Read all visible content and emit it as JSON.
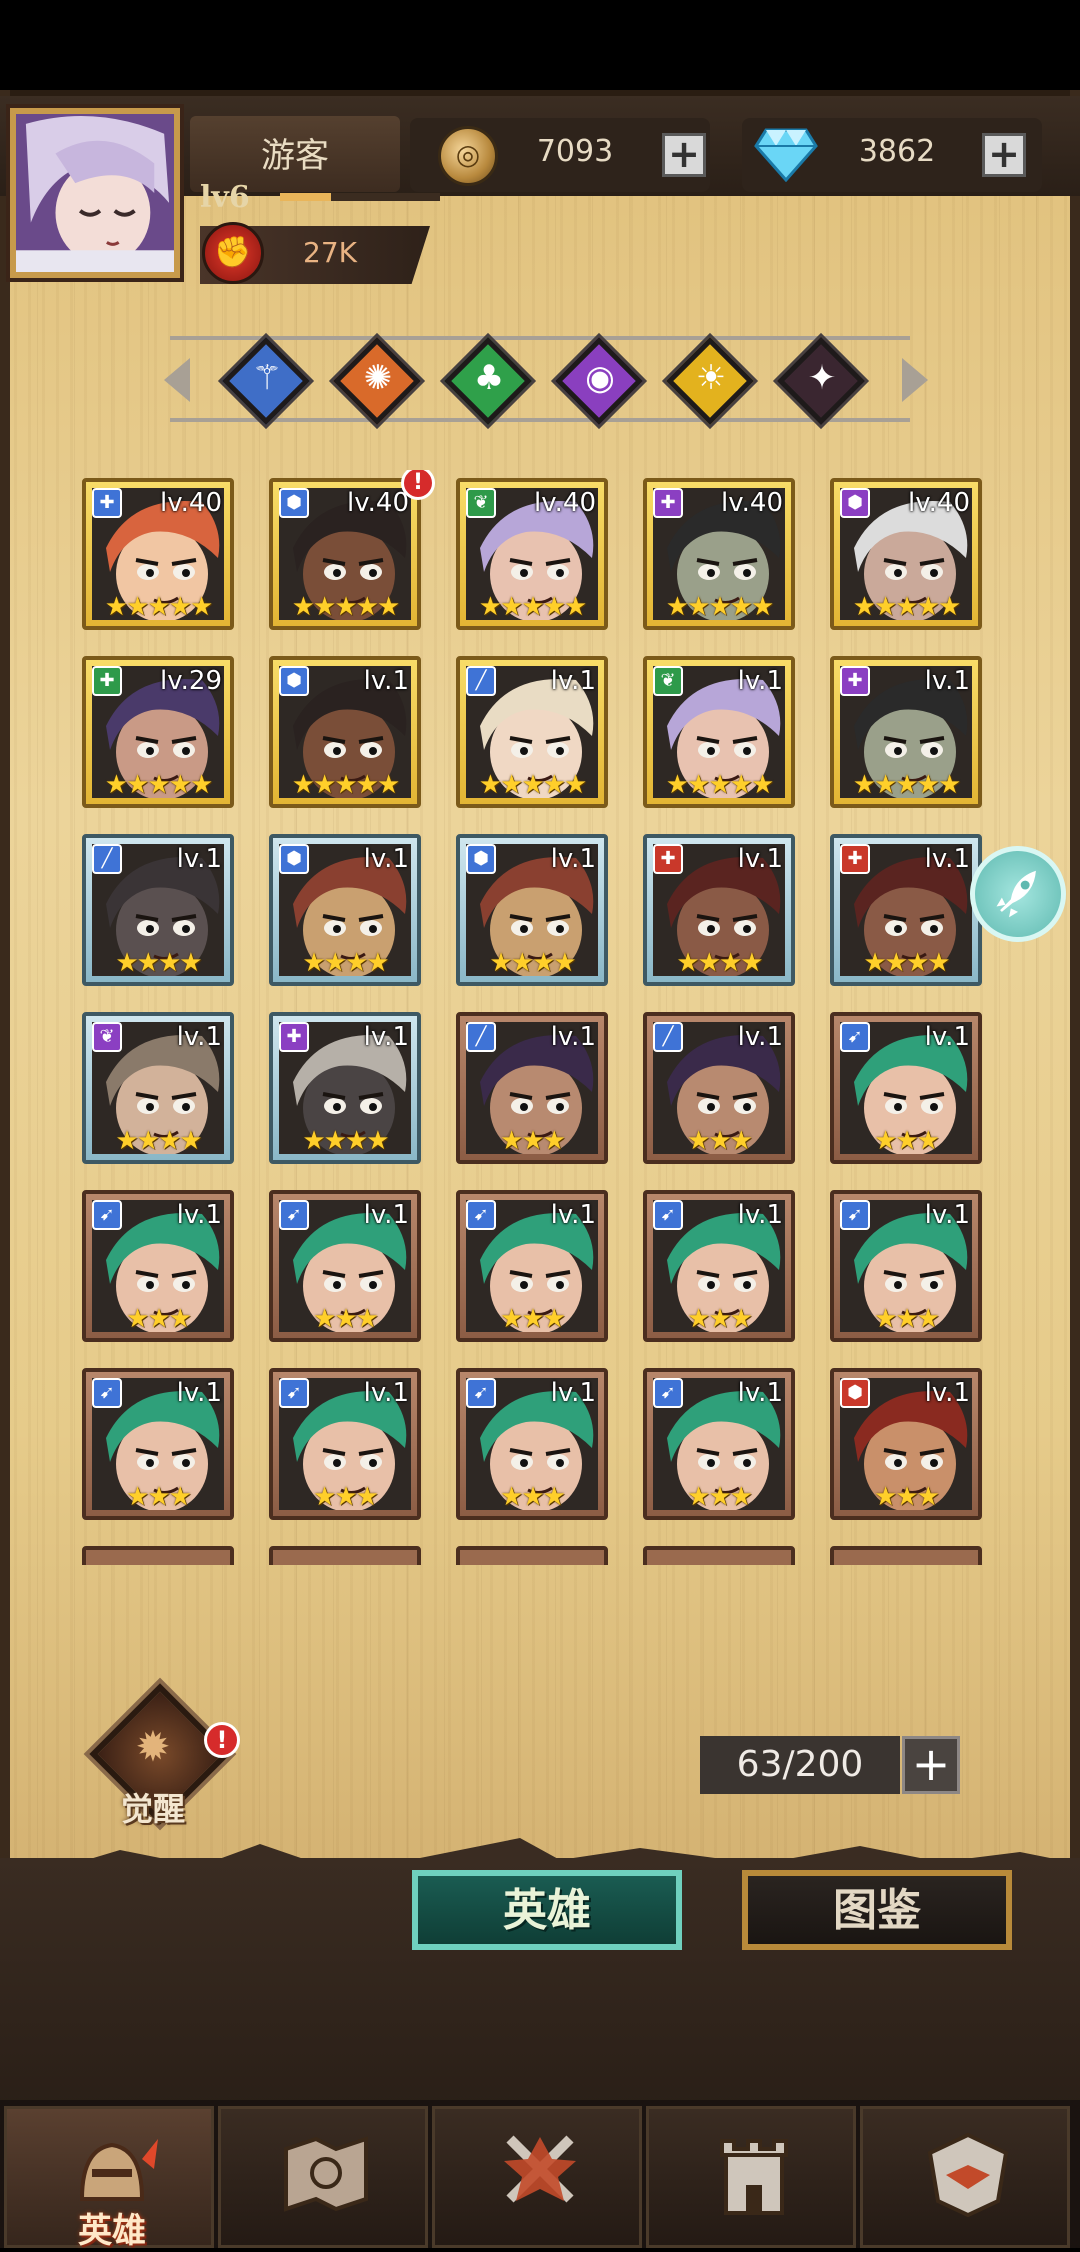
{
  "player": {
    "name": "游客",
    "level": "lv6",
    "exp_fraction": 0.32,
    "power": "27K",
    "power_icon": "fist-icon"
  },
  "currencies": [
    {
      "name": "coin",
      "icon": "coin-icon",
      "value": "7093"
    },
    {
      "name": "gem",
      "icon": "diamond-icon",
      "value": "3862"
    }
  ],
  "factions": [
    {
      "icon": "faction-blue-icon",
      "glyph": "⚚",
      "color": "#3f6ec7"
    },
    {
      "icon": "faction-orange-icon",
      "glyph": "✺",
      "color": "#d96a2a"
    },
    {
      "icon": "faction-green-icon",
      "glyph": "♣",
      "color": "#2fa04a"
    },
    {
      "icon": "faction-purple-icon",
      "glyph": "◉",
      "color": "#8a3fbf"
    },
    {
      "icon": "faction-yellow-icon",
      "glyph": "☀",
      "color": "#e3b21e"
    },
    {
      "icon": "faction-dark-icon",
      "glyph": "✦",
      "color": "#3a2630"
    }
  ],
  "class_colors": {
    "blue": "#3f73d6",
    "green": "#2e9a4a",
    "purple": "#8b3fc2",
    "red": "#c9382a"
  },
  "heroes": [
    {
      "level": "lv.40",
      "stars": 5,
      "tier": "gold",
      "cls": "blue",
      "cls_glyph": "✚",
      "hair": "#d8643e",
      "skin": "#f1c6a3",
      "alert": false
    },
    {
      "level": "lv.40",
      "stars": 5,
      "tier": "gold",
      "cls": "blue",
      "cls_glyph": "⬢",
      "hair": "#2a2220",
      "skin": "#7a4e38",
      "alert": true
    },
    {
      "level": "lv.40",
      "stars": 5,
      "tier": "gold",
      "cls": "green",
      "cls_glyph": "❦",
      "hair": "#b7a6d8",
      "skin": "#e8c2b0",
      "alert": false
    },
    {
      "level": "lv.40",
      "stars": 5,
      "tier": "gold",
      "cls": "purple",
      "cls_glyph": "✚",
      "hair": "#2a2a2a",
      "skin": "#9aa08a",
      "alert": false
    },
    {
      "level": "lv.40",
      "stars": 5,
      "tier": "gold",
      "cls": "purple",
      "cls_glyph": "⬢",
      "hair": "#dcdcdc",
      "skin": "#caa99a",
      "alert": false
    },
    {
      "level": "lv.29",
      "stars": 5,
      "tier": "gold",
      "cls": "green",
      "cls_glyph": "✚",
      "hair": "#4a3a6a",
      "skin": "#c99a86",
      "alert": false
    },
    {
      "level": "lv.1",
      "stars": 5,
      "tier": "gold",
      "cls": "blue",
      "cls_glyph": "⬢",
      "hair": "#2a2220",
      "skin": "#7a4e38",
      "alert": false
    },
    {
      "level": "lv.1",
      "stars": 5,
      "tier": "gold",
      "cls": "blue",
      "cls_glyph": "╱",
      "hair": "#e9dcc4",
      "skin": "#f0d8c4",
      "alert": false
    },
    {
      "level": "lv.1",
      "stars": 5,
      "tier": "gold",
      "cls": "green",
      "cls_glyph": "❦",
      "hair": "#b7a6d8",
      "skin": "#e8c2b0",
      "alert": false
    },
    {
      "level": "lv.1",
      "stars": 5,
      "tier": "gold",
      "cls": "purple",
      "cls_glyph": "✚",
      "hair": "#2a2a2a",
      "skin": "#9aa08a",
      "alert": false
    },
    {
      "level": "lv.1",
      "stars": 4,
      "tier": "blue",
      "cls": "blue",
      "cls_glyph": "╱",
      "hair": "#3a3436",
      "skin": "#5a5050",
      "alert": false
    },
    {
      "level": "lv.1",
      "stars": 4,
      "tier": "blue",
      "cls": "blue",
      "cls_glyph": "⬢",
      "hair": "#8a4030",
      "skin": "#c9a070",
      "alert": false
    },
    {
      "level": "lv.1",
      "stars": 4,
      "tier": "blue",
      "cls": "blue",
      "cls_glyph": "⬢",
      "hair": "#8a4030",
      "skin": "#c9a070",
      "alert": false
    },
    {
      "level": "lv.1",
      "stars": 4,
      "tier": "blue",
      "cls": "red",
      "cls_glyph": "✚",
      "hair": "#5a2420",
      "skin": "#8a5a46",
      "alert": false
    },
    {
      "level": "lv.1",
      "stars": 4,
      "tier": "blue",
      "cls": "red",
      "cls_glyph": "✚",
      "hair": "#5a2420",
      "skin": "#8a5a46",
      "alert": false
    },
    {
      "level": "lv.1",
      "stars": 4,
      "tier": "blue",
      "cls": "purple",
      "cls_glyph": "❦",
      "hair": "#8a7a6a",
      "skin": "#d2b29a",
      "alert": false
    },
    {
      "level": "lv.1",
      "stars": 4,
      "tier": "blue",
      "cls": "purple",
      "cls_glyph": "✚",
      "hair": "#b6b0a8",
      "skin": "#4a4444",
      "alert": false
    },
    {
      "level": "lv.1",
      "stars": 3,
      "tier": "bronze",
      "cls": "blue",
      "cls_glyph": "╱",
      "hair": "#3a2a4a",
      "skin": "#b88a70",
      "alert": false
    },
    {
      "level": "lv.1",
      "stars": 3,
      "tier": "bronze",
      "cls": "blue",
      "cls_glyph": "╱",
      "hair": "#3a2a4a",
      "skin": "#b88a70",
      "alert": false
    },
    {
      "level": "lv.1",
      "stars": 3,
      "tier": "bronze",
      "cls": "blue",
      "cls_glyph": "➹",
      "hair": "#2fa07a",
      "skin": "#e8c0a8",
      "alert": false
    },
    {
      "level": "lv.1",
      "stars": 3,
      "tier": "bronze",
      "cls": "blue",
      "cls_glyph": "➹",
      "hair": "#2fa07a",
      "skin": "#e8c0a8",
      "alert": false
    },
    {
      "level": "lv.1",
      "stars": 3,
      "tier": "bronze",
      "cls": "blue",
      "cls_glyph": "➹",
      "hair": "#2fa07a",
      "skin": "#e8c0a8",
      "alert": false
    },
    {
      "level": "lv.1",
      "stars": 3,
      "tier": "bronze",
      "cls": "blue",
      "cls_glyph": "➹",
      "hair": "#2fa07a",
      "skin": "#e8c0a8",
      "alert": false
    },
    {
      "level": "lv.1",
      "stars": 3,
      "tier": "bronze",
      "cls": "blue",
      "cls_glyph": "➹",
      "hair": "#2fa07a",
      "skin": "#e8c0a8",
      "alert": false
    },
    {
      "level": "lv.1",
      "stars": 3,
      "tier": "bronze",
      "cls": "blue",
      "cls_glyph": "➹",
      "hair": "#2fa07a",
      "skin": "#e8c0a8",
      "alert": false
    },
    {
      "level": "lv.1",
      "stars": 3,
      "tier": "bronze",
      "cls": "blue",
      "cls_glyph": "➹",
      "hair": "#2fa07a",
      "skin": "#e8c0a8",
      "alert": false
    },
    {
      "level": "lv.1",
      "stars": 3,
      "tier": "bronze",
      "cls": "blue",
      "cls_glyph": "➹",
      "hair": "#2fa07a",
      "skin": "#e8c0a8",
      "alert": false
    },
    {
      "level": "lv.1",
      "stars": 3,
      "tier": "bronze",
      "cls": "blue",
      "cls_glyph": "➹",
      "hair": "#2fa07a",
      "skin": "#e8c0a8",
      "alert": false
    },
    {
      "level": "lv.1",
      "stars": 3,
      "tier": "bronze",
      "cls": "blue",
      "cls_glyph": "➹",
      "hair": "#2fa07a",
      "skin": "#e8c0a8",
      "alert": false
    },
    {
      "level": "lv.1",
      "stars": 3,
      "tier": "bronze",
      "cls": "red",
      "cls_glyph": "⬢",
      "hair": "#8a2a20",
      "skin": "#c9906a",
      "alert": false
    }
  ],
  "awaken": {
    "label": "觉醒",
    "icon": "awaken-icon",
    "alert": "!"
  },
  "capacity": {
    "text": "63/200"
  },
  "hero_tabs": {
    "active": "英雄",
    "inactive": "图鉴"
  },
  "bottom_nav": [
    {
      "icon": "hero-helmet-icon",
      "label": "英雄",
      "active": true
    },
    {
      "icon": "map-scroll-icon",
      "label": "",
      "active": false
    },
    {
      "icon": "battle-swords-icon",
      "label": "",
      "active": false
    },
    {
      "icon": "castle-tower-icon",
      "label": "",
      "active": false
    },
    {
      "icon": "guild-handshake-icon",
      "label": "",
      "active": false
    }
  ],
  "alert_glyph": "!",
  "plus_glyph": "+"
}
